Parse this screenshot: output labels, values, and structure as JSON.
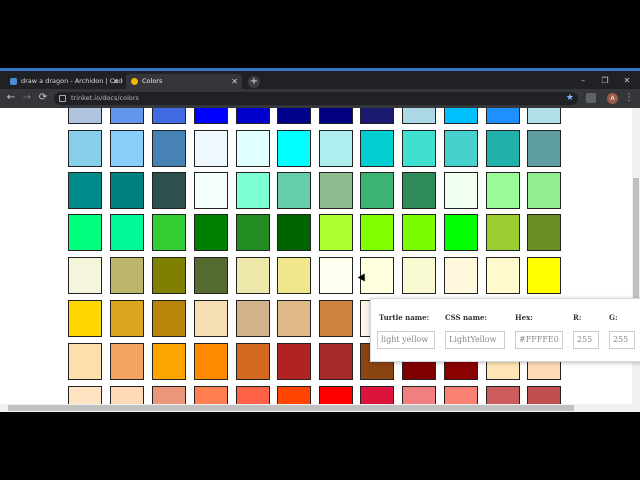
{
  "browser": {
    "tabs": [
      {
        "title": "draw a dragon - Archidon | Code",
        "favicon_color": "#4a8fd6",
        "active": false
      },
      {
        "title": "Colors",
        "favicon_color": "#f4b400",
        "active": true
      }
    ],
    "new_tab_symbol": "+",
    "window_controls": {
      "minimize": "–",
      "maximize": "❐",
      "close": "✕"
    },
    "nav": {
      "back": "←",
      "forward": "→",
      "reload": "⟳"
    },
    "url": "trinket.io/docs/colors",
    "bookmark_star": "★",
    "avatar_letter": "A",
    "menu": "⋮"
  },
  "palette": [
    [
      "#b0c4de",
      "#6495ed",
      "#4169e1",
      "#0000ff",
      "#0000cd",
      "#00008b",
      "#000080",
      "#191970",
      "#add8e6",
      "#00bfff",
      "#1e90ff",
      "#b0e0e6"
    ],
    [
      "#87ceeb",
      "#87cefa",
      "#4682b4",
      "#f0f8ff",
      "#e0ffff",
      "#00ffff",
      "#afeeee",
      "#00ced1",
      "#40e0d0",
      "#48d1cc",
      "#20b2aa",
      "#5f9ea0"
    ],
    [
      "#008b8b",
      "#008080",
      "#2f4f4f",
      "#f5fffa",
      "#7fffd4",
      "#66cdaa",
      "#8fbc8f",
      "#3cb371",
      "#2e8b57",
      "#f0fff0",
      "#98fb98",
      "#90ee90"
    ],
    [
      "#00ff7f",
      "#00fa9a",
      "#32cd32",
      "#008000",
      "#228b22",
      "#006400",
      "#adff2f",
      "#7fff00",
      "#7cfc00",
      "#00ff00",
      "#9acd32",
      "#6b8e23"
    ],
    [
      "#f5f5dc",
      "#bdb76b",
      "#808000",
      "#556b2f",
      "#eee8aa",
      "#f0e68c",
      "#fffff0",
      "#ffffe0",
      "#fafad2",
      "#fff8dc",
      "#fffacd",
      "#ffff00"
    ],
    [
      "#ffd700",
      "#daa520",
      "#b8860b",
      "#f5deb3",
      "#d2b48c",
      "#deb887",
      "#cd853f",
      "#fdf5e6",
      "#faf0e6",
      "#faebd7",
      "#ffefd5",
      "#ffe4c4"
    ],
    [
      "#ffdead",
      "#f4a460",
      "#ffa500",
      "#ff8c00",
      "#d2691e",
      "#b22222",
      "#a52a2a",
      "#8b4513",
      "#800000",
      "#8b0000",
      "#ffe4b5",
      "#ffdab9"
    ],
    [
      "#ffe4c4",
      "#ffdab9",
      "#e9967a",
      "#ff7f50",
      "#ff6347",
      "#ff4500",
      "#ff0000",
      "#dc143c",
      "#f08080",
      "#fa8072",
      "#cd5c5c",
      "#c0504d"
    ]
  ],
  "tooltip": {
    "headers": {
      "turtle": "Turtle name:",
      "css": "CSS name:",
      "hex": "Hex:",
      "r": "R:",
      "g": "G:"
    },
    "values": {
      "turtle": "light yellow",
      "css": "LightYellow",
      "hex": "#FFFFE0",
      "r": "255",
      "g": "255"
    }
  }
}
